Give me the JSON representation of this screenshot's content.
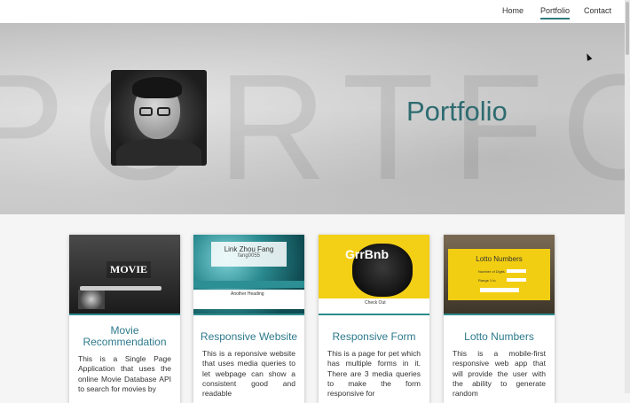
{
  "nav": {
    "links": [
      {
        "label": "Home"
      },
      {
        "label": "Portfolio"
      },
      {
        "label": "Contact"
      }
    ]
  },
  "hero": {
    "title": "Portfolio",
    "watermark": "PORTFOLIO"
  },
  "cards": [
    {
      "title": "Movie Recommendation",
      "thumb_text": "MOVIE",
      "description": "This is a Single Page Application that uses the online Movie Database API to search for movies by"
    },
    {
      "title": "Responsive Website",
      "thumb_text": "Link Zhou Fang",
      "thumb_subtext": "fang0055",
      "thumb_heading": "Another Heading",
      "description": "This is a reponsive website that uses media queries to let webpage can show a consistent good and readable"
    },
    {
      "title": "Responsive Form",
      "thumb_text": "GrrBnb",
      "thumb_subtext": "Check Out",
      "description": "This is a page for pet which has multiple forms in it. There are 3 media queries to make the form responsive for"
    },
    {
      "title": "Lotto Numbers",
      "thumb_text": "Lotto Numbers",
      "thumb_row1": "Number of Digits",
      "thumb_row2": "Range 1 to",
      "thumb_button": "Generate Numbers",
      "description": "This is a mobile-first responsive web app that will provide the user with the ability to generate random"
    }
  ],
  "colors": {
    "accent": "#2d7a7c",
    "title": "#2d6b70"
  }
}
